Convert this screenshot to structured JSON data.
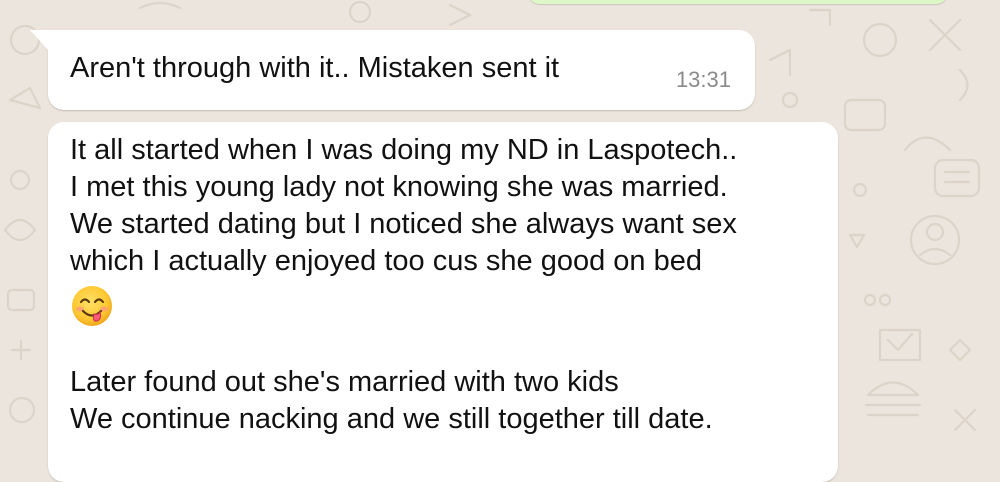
{
  "chat": {
    "messages": [
      {
        "direction": "incoming",
        "text": "Aren't through with it..  Mistaken sent it",
        "time": "13:31"
      },
      {
        "direction": "incoming",
        "lines": [
          "It all started when I was doing my ND in Laspotech..",
          "I met this young lady not knowing she was married.",
          "We started dating but I noticed she always want sex",
          "which I actually enjoyed too cus she good on bed",
          "Later found out she's married with two kids",
          "We continue nacking and we still together till date."
        ],
        "emoji": "smiling-face-with-tongue-emoji"
      }
    ]
  },
  "colors": {
    "background": "#ece5dd",
    "incoming_bubble": "#ffffff",
    "outgoing_bubble": "#dcf8c6",
    "timestamp": "#8a8a8a"
  }
}
